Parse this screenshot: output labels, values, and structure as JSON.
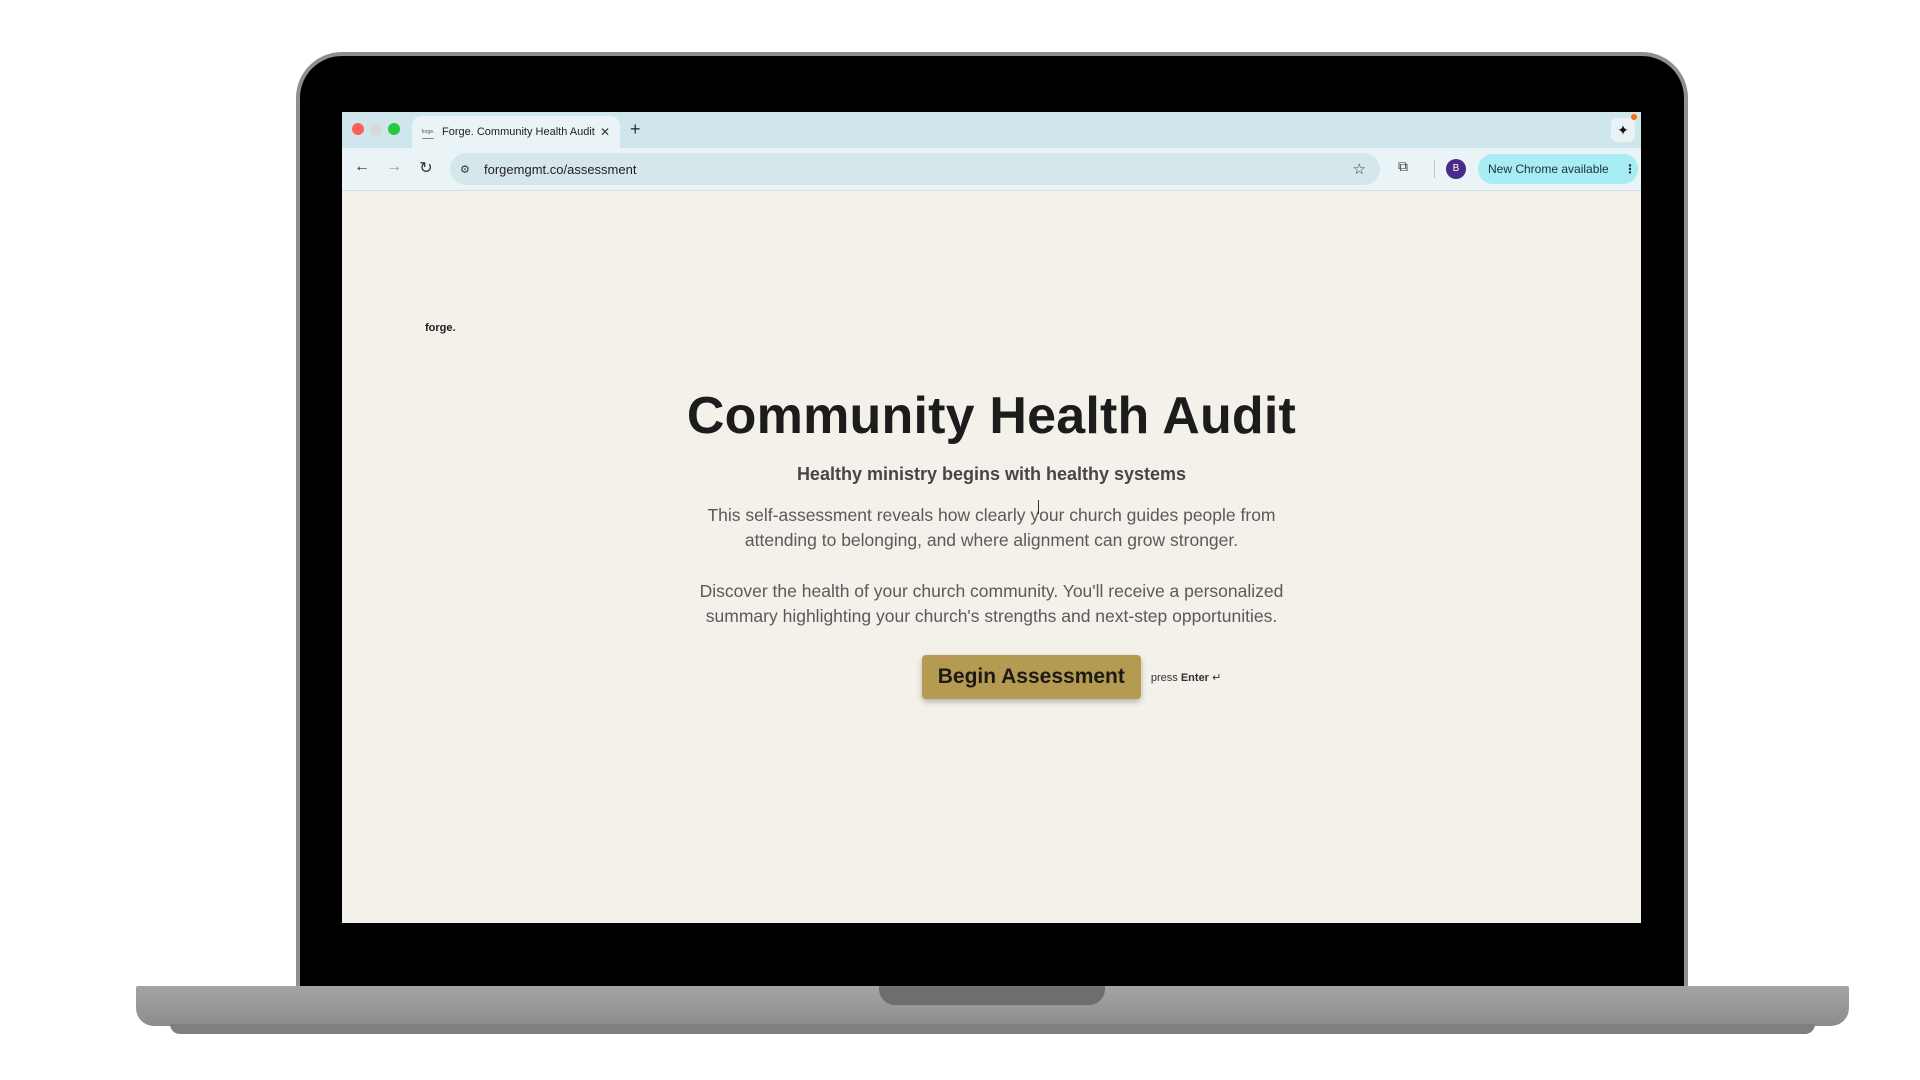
{
  "browser": {
    "tab": {
      "favicon_text": "forge.",
      "title": "Forge. Community Health Audit",
      "close_glyph": "✕"
    },
    "new_tab_glyph": "+",
    "gemini_glyph": "✦",
    "toolbar": {
      "back_glyph": "←",
      "forward_glyph": "→",
      "reload_glyph": "↻",
      "site_info_glyph": "⚙",
      "url": "forgemgmt.co/assessment",
      "star_glyph": "☆",
      "extension_glyph": "⧉",
      "profile_initial": "B",
      "update_label": "New Chrome available",
      "update_menu_glyph": "⋮"
    }
  },
  "page": {
    "logo": "forge.",
    "title": "Community Health Audit",
    "subtitle": "Healthy ministry begins with healthy systems",
    "paragraph_1": "This self-assessment reveals how clearly your church guides people from attending to belonging, and where alignment can grow stronger.",
    "paragraph_2": "Discover the health of your church community. You'll receive a personalized summary highlighting your church's strengths and next-step opportunities.",
    "cta_label": "Begin Assessment",
    "hint_prefix": "press",
    "hint_key": "Enter",
    "hint_glyph": "↵"
  },
  "colors": {
    "page_background": "#f4f0ea",
    "button_background": "#b59b52",
    "tabbar_background": "#cfe6ec",
    "update_pill": "#a8ecf4",
    "avatar": "#4c2a8a"
  }
}
